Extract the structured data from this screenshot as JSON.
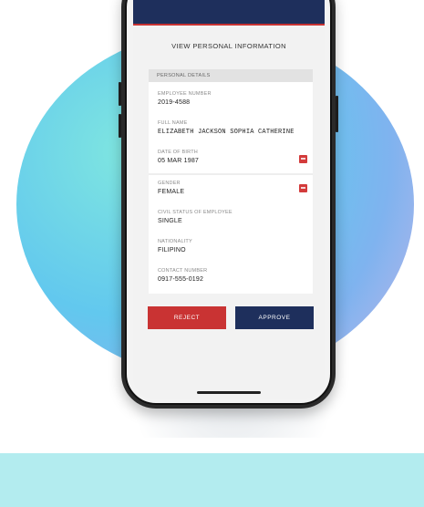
{
  "form": {
    "title": "VIEW PERSONAL INFORMATION",
    "section_title": "PERSONAL DETAILS"
  },
  "fields": [
    {
      "label": "EMPLOYEE NUMBER",
      "value": "2019-4588"
    },
    {
      "label": "FULL NAME",
      "value": "ELIZABETH JACKSON SOPHIA CATHERINE"
    },
    {
      "label": "DATE OF BIRTH",
      "value": "05 MAR 1987"
    },
    {
      "label": "GENDER",
      "value": "FEMALE"
    },
    {
      "label": "CIVIL STATUS OF EMPLOYEE",
      "value": "SINGLE"
    },
    {
      "label": "NATIONALITY",
      "value": "FILIPINO"
    },
    {
      "label": "CONTACT NUMBER",
      "value": "0917-555-0192"
    }
  ],
  "actions": {
    "reject_label": "REJECT",
    "approve_label": "APPROVE"
  },
  "colors": {
    "navy": "#1e2f5c",
    "red": "#c93333",
    "band": "#b3ecef"
  }
}
